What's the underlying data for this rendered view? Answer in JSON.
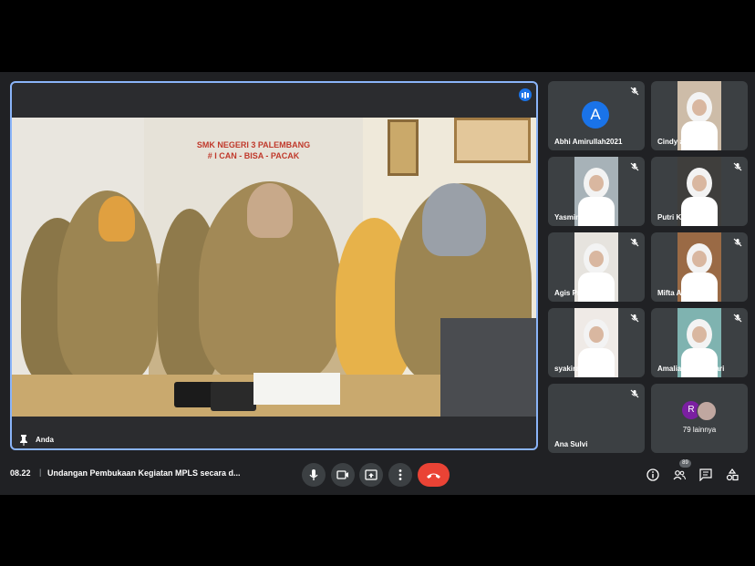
{
  "main": {
    "pinned_name": "Anda",
    "banner_lines": [
      "SMK NEGERI 3 PALEMBANG",
      "# I CAN - BISA - PACAK"
    ]
  },
  "participants": [
    {
      "name": "Abhi Amirullah2021",
      "avatar_letter": "A"
    },
    {
      "name": "Cindy aleda Putri"
    },
    {
      "name": "Yasmin Annisa"
    },
    {
      "name": "Putri Kirani"
    },
    {
      "name": "Agis Pratiwi"
    },
    {
      "name": "Mifta Aaljanah"
    },
    {
      "name": "syakira salsabila"
    },
    {
      "name": "Amalia virna lestari"
    },
    {
      "name": "Ana Sulvi"
    }
  ],
  "more": {
    "avatar_letter": "R",
    "label": "79 lainnya"
  },
  "bottom_bar": {
    "time": "08.22",
    "separator": "|",
    "meeting_title": "Undangan Pembukaan Kegiatan MPLS secara d...",
    "participants_badge": "89"
  },
  "icons": [
    "speaking-indicator-icon",
    "pin-icon",
    "mic-off-icon",
    "mic-icon",
    "camera-icon",
    "present-icon",
    "more-options-icon",
    "end-call-icon",
    "info-icon",
    "people-icon",
    "chat-icon",
    "activities-icon"
  ],
  "colors": {
    "accent": "#8ab4f8",
    "end_call": "#ea4335",
    "avatar_blue": "#1a73e8",
    "avatar_purple": "#7b1fa2"
  }
}
